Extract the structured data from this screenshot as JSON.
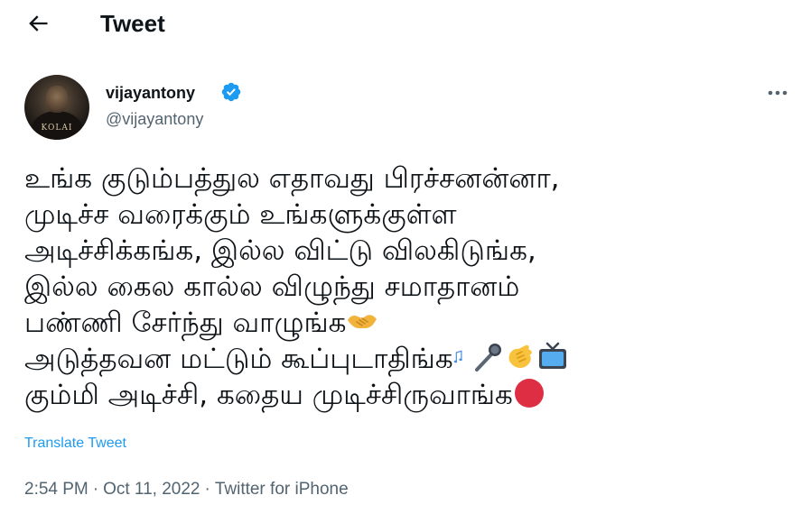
{
  "header": {
    "back_icon": "back-arrow-icon",
    "title": "Tweet"
  },
  "author": {
    "display_name": "vijayantony",
    "handle": "@vijayantony",
    "verified": true,
    "verified_color": "#1d9bf0",
    "avatar_text": "KOLAI"
  },
  "tweet": {
    "lines": [
      "உங்க குடும்பத்துல எதாவது பிரச்சனன்னா,",
      "முடிச்ச வரைக்கும் உங்களுக்குள்ள",
      "அடிச்சிக்கங்க, இல்ல விட்டு விலகிடுங்க,",
      "இல்ல கைல கால்ல விழுந்து சமாதானம்",
      "பண்ணி சேர்ந்து வாழுங்க",
      "அடுத்தவன மட்டும் கூப்புடாதிங்க",
      "கும்மி அடிச்சி, கதைய முடிச்சிருவாங்க"
    ],
    "emojis": {
      "line5": [
        "handshake"
      ],
      "line6": [
        "musical-notes",
        "microphone",
        "clapping-hands",
        "television"
      ],
      "line7": [
        "red-circle"
      ]
    },
    "translate_label": "Translate Tweet"
  },
  "meta": {
    "time": "2:54 PM",
    "separator": "·",
    "date": "Oct 11, 2022",
    "source": "Twitter for iPhone"
  },
  "colors": {
    "accent": "#1d9bf0",
    "text_primary": "#0f1419",
    "text_secondary": "#536471",
    "background": "#ffffff"
  }
}
